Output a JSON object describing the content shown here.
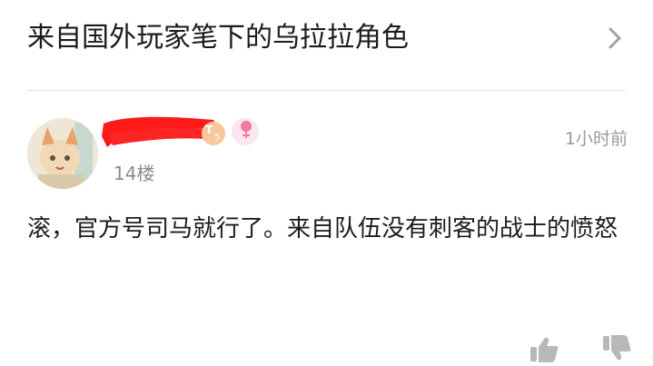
{
  "thread": {
    "title": "来自国外玩家笔下的乌拉拉角色"
  },
  "post": {
    "timestamp": "1小时前",
    "floor": "14楼",
    "level_badge": {
      "letter": "T",
      "number": "5"
    },
    "content": "滚，官方号司马就行了。来自队伍没有刺客的战士的愤怒"
  },
  "icons": {
    "chevron": "chevron-right-icon",
    "gender": "female-icon",
    "like": "thumbs-up-icon",
    "dislike": "thumbs-down-icon"
  },
  "colors": {
    "redaction": "#ff1a1a",
    "level_badge": "#f6c89a",
    "gender_icon": "#f07aa0",
    "timestamp": "#9a9a9a"
  }
}
